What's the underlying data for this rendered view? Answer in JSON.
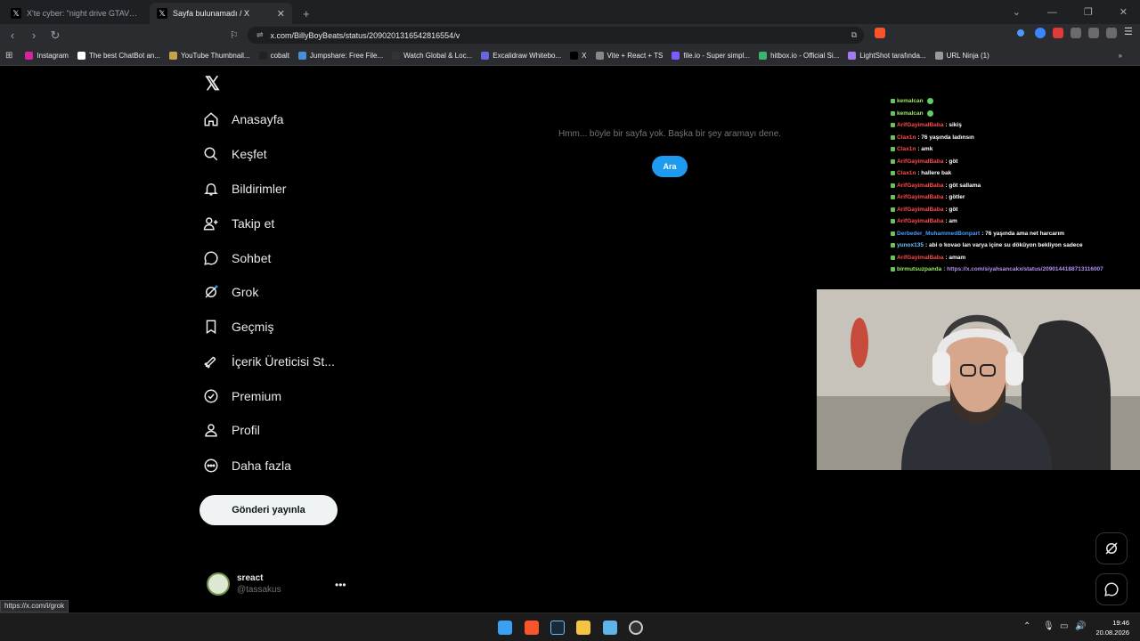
{
  "browser": {
    "tabs": [
      {
        "title": "X'te cyber: \"night drive GTAVI look in",
        "active": false
      },
      {
        "title": "Sayfa bulunamadı / X",
        "active": true
      }
    ],
    "url": "x.com/BillyBoyBeats/status/2090201316542816554/v",
    "bookmarks": [
      {
        "label": "Instagram",
        "color": "#d6249f"
      },
      {
        "label": "The best ChatBot an...",
        "color": "#ffffff"
      },
      {
        "label": "YouTube Thumbnail...",
        "color": "#c8a24a"
      },
      {
        "label": "cobalt",
        "color": "#222222"
      },
      {
        "label": "Jumpshare: Free File...",
        "color": "#4a8fd6"
      },
      {
        "label": "Watch Global & Loc...",
        "color": "#333333"
      },
      {
        "label": "Excalidraw Whitebo...",
        "color": "#6965db"
      },
      {
        "label": "X",
        "color": "#000000"
      },
      {
        "label": "Vite + React + TS",
        "color": "#888888"
      },
      {
        "label": "file.io - Super simpl...",
        "color": "#7a5cff"
      },
      {
        "label": "hitbox.io - Official Si...",
        "color": "#3cb371"
      },
      {
        "label": "LightShot tarafında...",
        "color": "#a07cf0"
      },
      {
        "label": "URL Ninja (1)",
        "color": "#999999"
      }
    ]
  },
  "sidebar": {
    "items": [
      {
        "label": "Anasayfa",
        "icon": "home-icon"
      },
      {
        "label": "Keşfet",
        "icon": "search-icon"
      },
      {
        "label": "Bildirimler",
        "icon": "bell-icon"
      },
      {
        "label": "Takip et",
        "icon": "add-person-icon"
      },
      {
        "label": "Sohbet",
        "icon": "chat-icon"
      },
      {
        "label": "Grok",
        "icon": "grok-icon"
      },
      {
        "label": "Geçmiş",
        "icon": "bookmark-icon"
      },
      {
        "label": "İçerik Üreticisi St...",
        "icon": "rocket-icon"
      },
      {
        "label": "Premium",
        "icon": "verified-icon"
      },
      {
        "label": "Profil",
        "icon": "person-icon"
      },
      {
        "label": "Daha fazla",
        "icon": "more-circle-icon"
      }
    ],
    "post_label": "Gönderi yayınla",
    "account": {
      "name": "sreact",
      "handle": "@tassakus"
    }
  },
  "main": {
    "error_message": "Hmm... böyle bir sayfa yok. Başka bir şey aramayı dene.",
    "search_button": "Ara"
  },
  "chat": {
    "lines": [
      {
        "user": "kemalcan",
        "msg": "",
        "color": "#9be86a"
      },
      {
        "user": "kemalcan",
        "msg": "",
        "color": "#9be86a"
      },
      {
        "user": "ArifGayimalBaba",
        "msg": ": sikiş",
        "color": "#ff4a4a"
      },
      {
        "user": "Clax1n",
        "msg": ": 76 yaşında ladınsın",
        "color": "#ff4a4a"
      },
      {
        "user": "Clax1n",
        "msg": ": amk",
        "color": "#ff4a4a"
      },
      {
        "user": "ArifGayimalBaba",
        "msg": ": göt",
        "color": "#ff4a4a"
      },
      {
        "user": "Clax1n",
        "msg": ": hallere bak",
        "color": "#ff4a4a"
      },
      {
        "user": "ArifGayimalBaba",
        "msg": ": göt sallama",
        "color": "#ff4a4a"
      },
      {
        "user": "ArifGayimalBaba",
        "msg": ": götler",
        "color": "#ff4a4a"
      },
      {
        "user": "ArifGayimalBaba",
        "msg": ": göt",
        "color": "#ff4a4a"
      },
      {
        "user": "ArifGayimalBaba",
        "msg": ": am",
        "color": "#ff4a4a"
      },
      {
        "user": "Derbeder_MuhammedBonpart",
        "msg": ": 76 yaşında ama net harcarım",
        "color": "#4a9aff"
      },
      {
        "user": "yunox135",
        "msg": ": abi o kovao lan varya içine su döküyon bekliyon sadece",
        "color": "#6ac3ff"
      },
      {
        "user": "ArifGayimalBaba",
        "msg": ": amam",
        "color": "#ff4a4a"
      },
      {
        "user": "birmutsuzpanda",
        "msg": ": https://x.com/siyahsancakx/status/2090144188713116007",
        "color": "#9be86a"
      }
    ]
  },
  "status_url": "https://x.com/i/grok",
  "clock": {
    "time": "19:46",
    "date": "20.08.2026"
  }
}
